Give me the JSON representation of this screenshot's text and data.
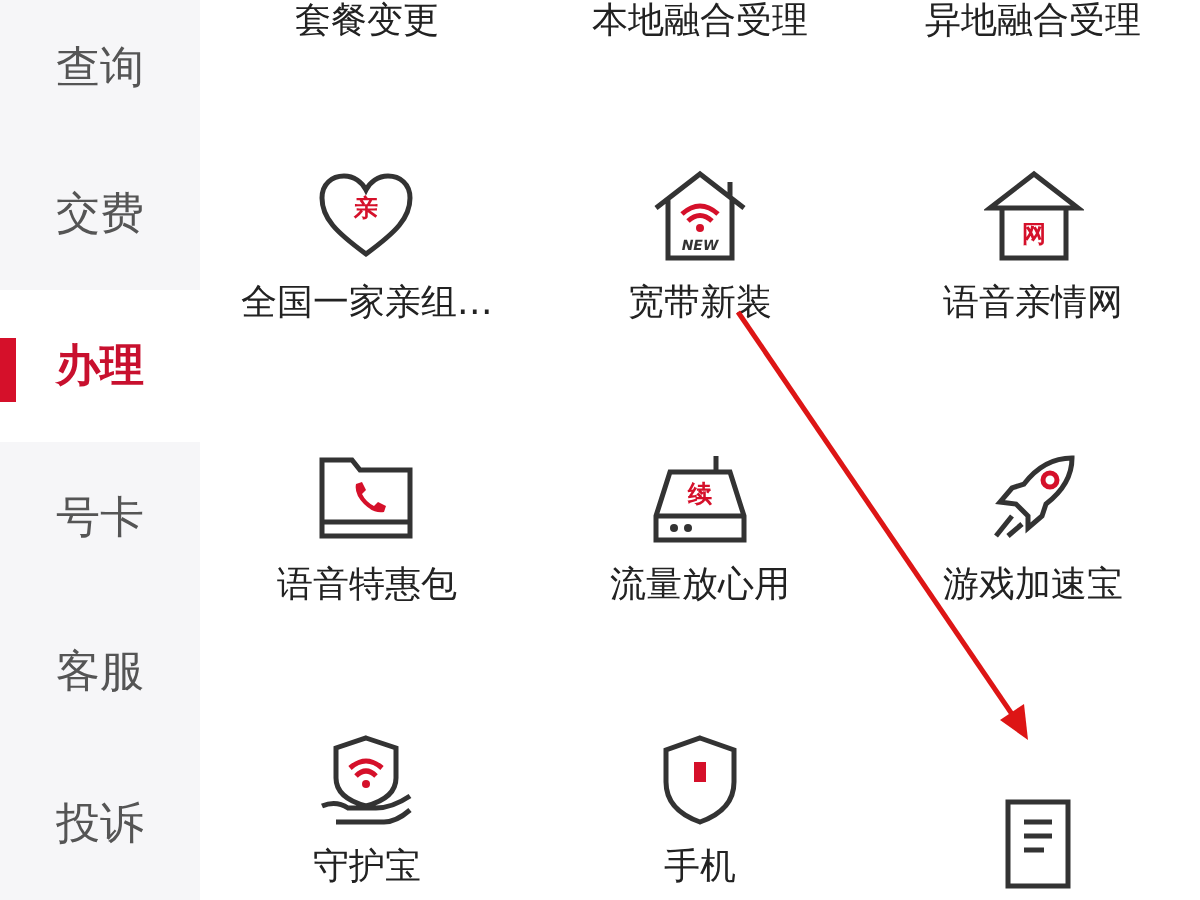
{
  "sidebar": {
    "items": [
      {
        "label": "查询",
        "selected": false
      },
      {
        "label": "交费",
        "selected": false
      },
      {
        "label": "办理",
        "selected": true
      },
      {
        "label": "号卡",
        "selected": false
      },
      {
        "label": "客服",
        "selected": false
      },
      {
        "label": "投诉",
        "selected": false
      }
    ]
  },
  "services": [
    {
      "label": "套餐变更",
      "kind": "none"
    },
    {
      "label": "本地融合受理",
      "kind": "none"
    },
    {
      "label": "异地融合受理",
      "kind": "none"
    },
    {
      "label": "全国一家亲组…",
      "kind": "heart",
      "icon_text": "亲"
    },
    {
      "label": "宽带新装",
      "kind": "house-wifi",
      "icon_text": "NEW"
    },
    {
      "label": "语音亲情网",
      "kind": "house",
      "icon_text": "网"
    },
    {
      "label": "语音特惠包",
      "kind": "folder-phone"
    },
    {
      "label": "流量放心用",
      "kind": "router",
      "icon_text": "续"
    },
    {
      "label": "游戏加速宝",
      "kind": "rocket"
    },
    {
      "label": "守护宝",
      "kind": "shield-hand"
    },
    {
      "label": "手机",
      "kind": "shield"
    },
    {
      "kind": "document"
    }
  ]
}
